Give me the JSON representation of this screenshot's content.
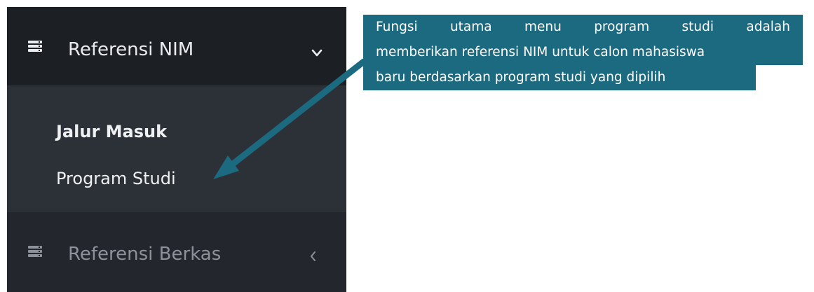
{
  "sidebar": {
    "menu_nim": {
      "label": "Referensi NIM",
      "icon": "server-icon",
      "indicator": "⌄",
      "expanded": true
    },
    "submenu": [
      {
        "label": "Jalur Masuk",
        "active": true
      },
      {
        "label": "Program Studi",
        "active": false
      }
    ],
    "menu_berkas": {
      "label": "Referensi Berkas",
      "icon": "server-icon",
      "indicator": "‹",
      "expanded": false
    }
  },
  "annotation": {
    "line1_words": [
      "Fungsi",
      "utama",
      "menu",
      "program",
      "studi",
      "adalah"
    ],
    "line2": "memberikan referensi NIM untuk calon mahasiswa",
    "line3": "baru berdasarkan program studi yang dipilih",
    "color": "#1c6a80"
  },
  "colors": {
    "sidebar_header": "#1c1f24",
    "sidebar_submenu": "#2c3037",
    "sidebar_body": "#23262d",
    "text_light": "#e9ebee",
    "text_dim": "#8d929a"
  }
}
